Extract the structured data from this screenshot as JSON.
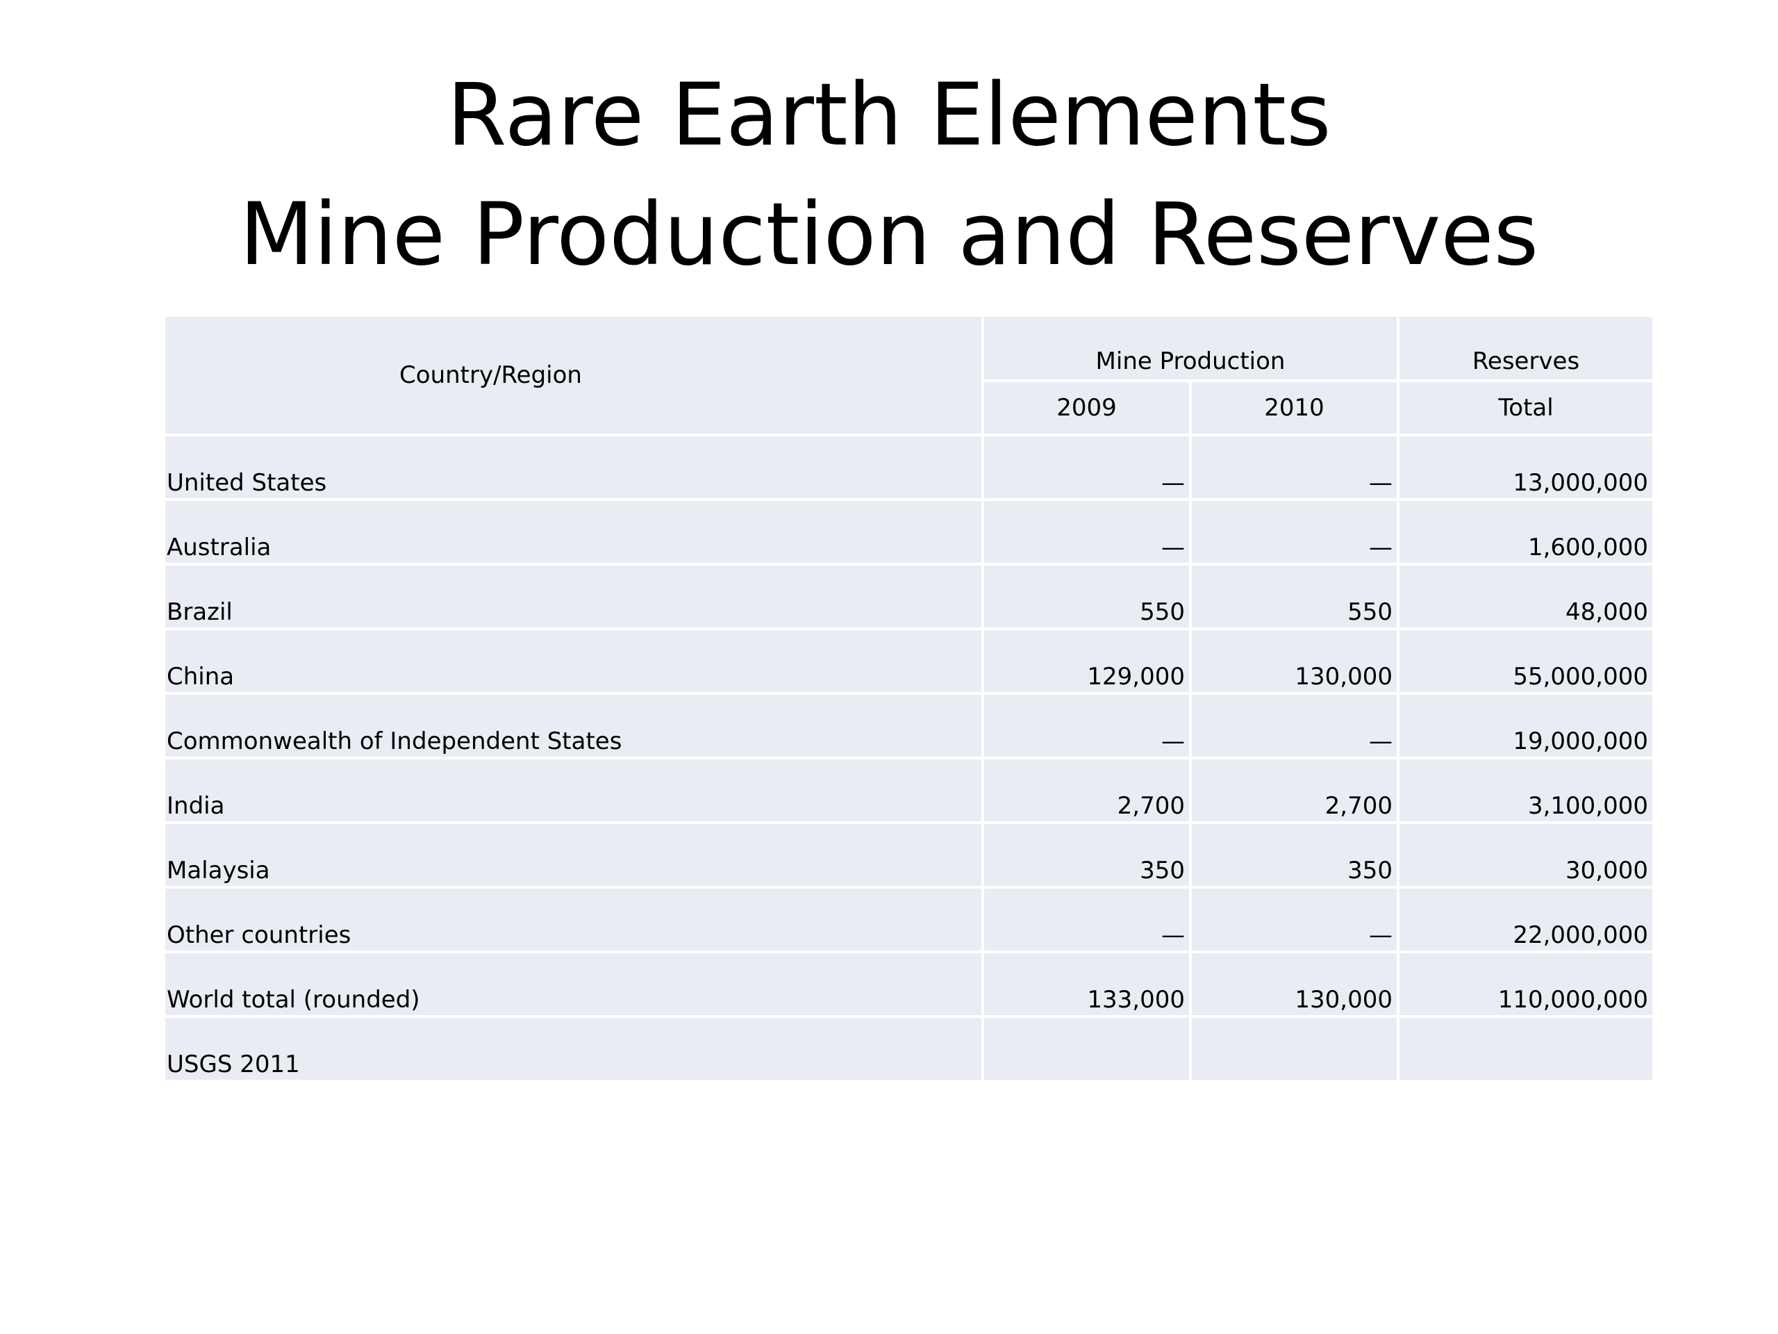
{
  "slide": {
    "title_line1": "Rare Earth Elements",
    "title_line2": "Mine Production and Reserves"
  },
  "table": {
    "headers": {
      "country": "Country/Region",
      "mine_production": "Mine Production",
      "reserves": "Reserves",
      "year_2009": "2009",
      "year_2010": "2010",
      "total": "Total"
    },
    "rows": [
      {
        "country": "United States",
        "y2009": "—",
        "y2010": "—",
        "total": "13,000,000"
      },
      {
        "country": "Australia",
        "y2009": "—",
        "y2010": "—",
        "total": "1,600,000"
      },
      {
        "country": "Brazil",
        "y2009": "550",
        "y2010": "550",
        "total": "48,000"
      },
      {
        "country": "China",
        "y2009": "129,000",
        "y2010": "130,000",
        "total": "55,000,000"
      },
      {
        "country": "Commonwealth of Independent States",
        "y2009": "—",
        "y2010": "—",
        "total": "19,000,000"
      },
      {
        "country": "India",
        "y2009": "2,700",
        "y2010": "2,700",
        "total": "3,100,000"
      },
      {
        "country": "Malaysia",
        "y2009": "350",
        "y2010": "350",
        "total": "30,000"
      },
      {
        "country": "Other countries",
        "y2009": "—",
        "y2010": "—",
        "total": "22,000,000"
      },
      {
        "country": "World total (rounded)",
        "y2009": "133,000",
        "y2010": "130,000",
        "total": "110,000,000"
      },
      {
        "country": "USGS 2011",
        "y2009": "",
        "y2010": "",
        "total": ""
      }
    ]
  },
  "colors": {
    "cell_background": "#e9ecf3",
    "cell_border": "#ffffff",
    "text": "#000000"
  }
}
